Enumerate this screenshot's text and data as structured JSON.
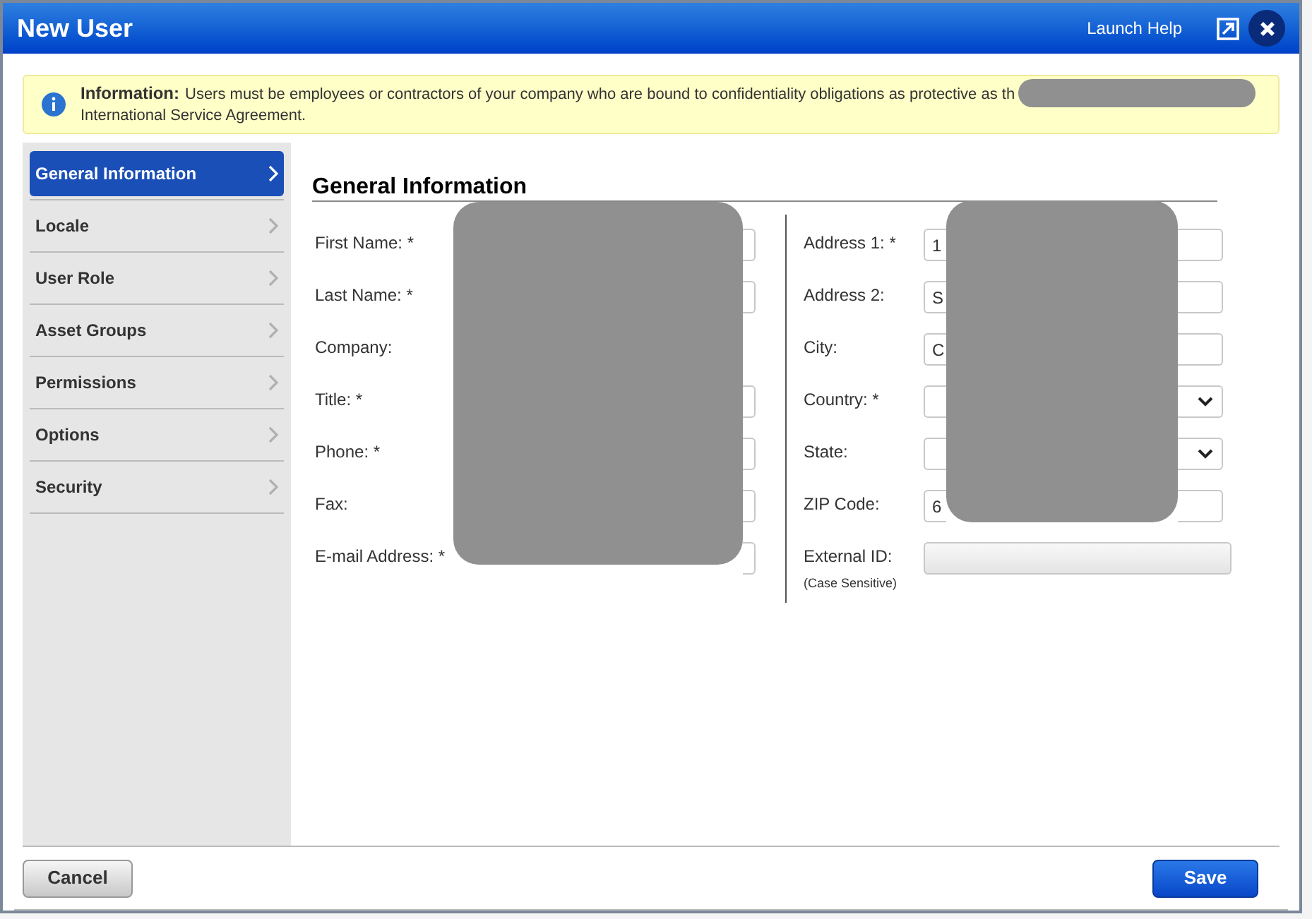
{
  "window": {
    "title": "New User",
    "help_link": "Launch Help"
  },
  "info": {
    "title": "Information:",
    "message": [
      "Users must be employees or contractors of your company who are bound to confidentiality obligations as protective as th",
      "International Service Agreement."
    ]
  },
  "sidebar": {
    "items": [
      {
        "label": "General Information",
        "selected": true
      },
      {
        "label": "Locale",
        "selected": false
      },
      {
        "label": "User Role",
        "selected": false
      },
      {
        "label": "Asset Groups",
        "selected": false
      },
      {
        "label": "Permissions",
        "selected": false
      },
      {
        "label": "Options",
        "selected": false
      },
      {
        "label": "Security",
        "selected": false
      }
    ]
  },
  "section": {
    "title": "General Information"
  },
  "left_fields": [
    {
      "label": "First Name: *",
      "kind": "text"
    },
    {
      "label": "Last Name: *",
      "kind": "text"
    },
    {
      "label": "Company:",
      "kind": "label"
    },
    {
      "label": "Title: *",
      "kind": "text"
    },
    {
      "label": "Phone: *",
      "kind": "text"
    },
    {
      "label": "Fax:",
      "kind": "text"
    },
    {
      "label": "E-mail Address: *",
      "kind": "text"
    }
  ],
  "right_fields": [
    {
      "label": "Address 1: *",
      "kind": "text",
      "value": "1"
    },
    {
      "label": "Address 2:",
      "kind": "text",
      "value": "S"
    },
    {
      "label": "City:",
      "kind": "text",
      "value": "C"
    },
    {
      "label": "Country: *",
      "kind": "select"
    },
    {
      "label": "State:",
      "kind": "select"
    },
    {
      "label": "ZIP Code:",
      "kind": "text",
      "value": "6"
    },
    {
      "label": "External ID:",
      "kind": "disabled",
      "note": "(Case Sensitive)"
    }
  ],
  "buttons": {
    "cancel": "Cancel",
    "save": "Save"
  }
}
